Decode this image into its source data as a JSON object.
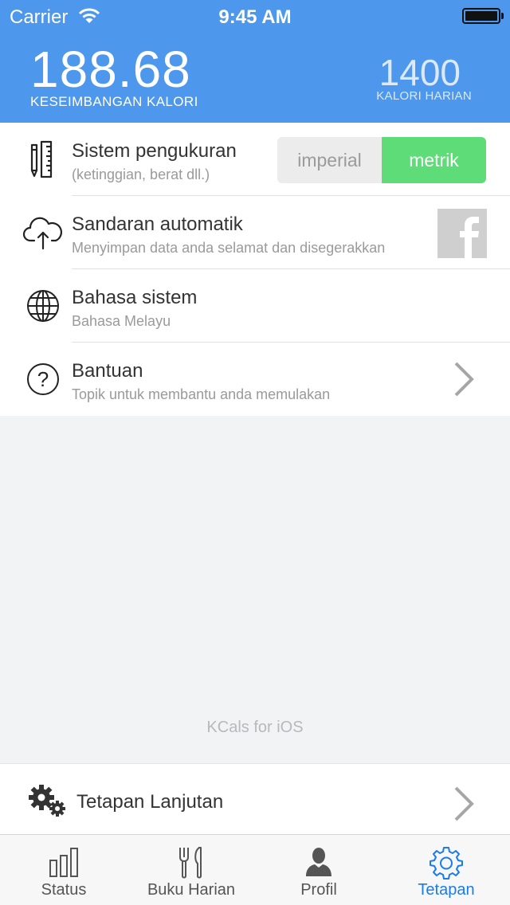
{
  "status_bar": {
    "carrier": "Carrier",
    "time": "9:45 AM"
  },
  "header": {
    "balance_value": "188.68",
    "balance_label": "KESEIMBANGAN KALORI",
    "daily_value": "1400",
    "daily_label": "KALORI HARIAN"
  },
  "settings": {
    "measurement": {
      "title": "Sistem pengukuran",
      "subtitle": "(ketinggian, berat dll.)",
      "options": [
        "imperial",
        "metrik"
      ],
      "selected": "metrik"
    },
    "backup": {
      "title": "Sandaran automatik",
      "subtitle": "Menyimpan data anda selamat dan disegerakkan"
    },
    "language": {
      "title": "Bahasa sistem",
      "subtitle": "Bahasa Melayu"
    },
    "help": {
      "title": "Bantuan",
      "subtitle": "Topik untuk membantu anda memulakan"
    }
  },
  "footer_note": "KCals for iOS",
  "advanced": {
    "title": "Tetapan Lanjutan"
  },
  "tabs": [
    {
      "label": "Status",
      "icon": "bar-chart-icon",
      "active": false
    },
    {
      "label": "Buku Harian",
      "icon": "fork-knife-icon",
      "active": false
    },
    {
      "label": "Profil",
      "icon": "person-icon",
      "active": false
    },
    {
      "label": "Tetapan",
      "icon": "gear-icon",
      "active": true
    }
  ],
  "colors": {
    "header": "#4d97ec",
    "toggle_active": "#5edc78",
    "tab_active": "#1a7ce8"
  }
}
